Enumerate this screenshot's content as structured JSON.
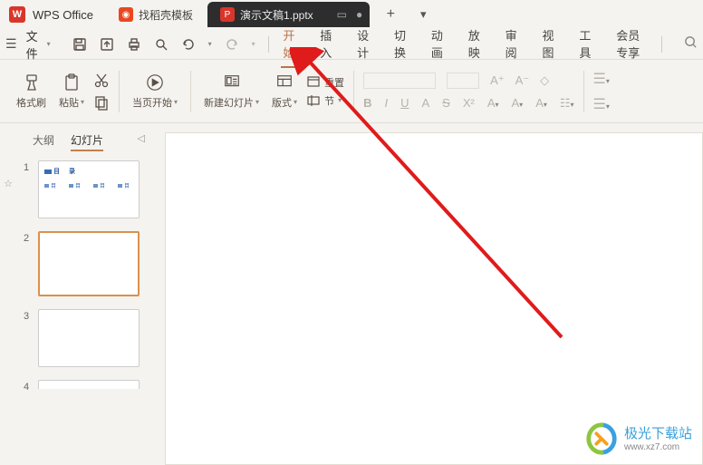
{
  "titlebar": {
    "app_name": "WPS Office",
    "tab_docer": "找稻壳模板",
    "tab_active": "演示文稿1.pptx",
    "new_tab": "+"
  },
  "menubar": {
    "file": "文件",
    "tabs": [
      "开始",
      "插入",
      "设计",
      "切换",
      "动画",
      "放映",
      "审阅",
      "视图",
      "工具",
      "会员专享"
    ]
  },
  "ribbon": {
    "format_painter": "格式刷",
    "paste": "粘贴",
    "from_current": "当页开始",
    "new_slide": "新建幻灯片",
    "layout": "版式",
    "section": "节",
    "reset": "重置",
    "font_controls": {
      "b": "B",
      "i": "I",
      "u": "U",
      "a1": "A",
      "s": "S",
      "sup": "X²",
      "color": "A",
      "fill": "A",
      "effect": "A"
    }
  },
  "sidepanel": {
    "tabs": {
      "outline": "大纲",
      "slides": "幻灯片"
    },
    "slide1": {
      "title": "目    录",
      "items": [
        "目",
        "目",
        "目",
        "目"
      ]
    },
    "thumbs": [
      "1",
      "2",
      "3",
      "4"
    ]
  },
  "watermark": {
    "name": "极光下载站",
    "url": "www.xz7.com"
  }
}
